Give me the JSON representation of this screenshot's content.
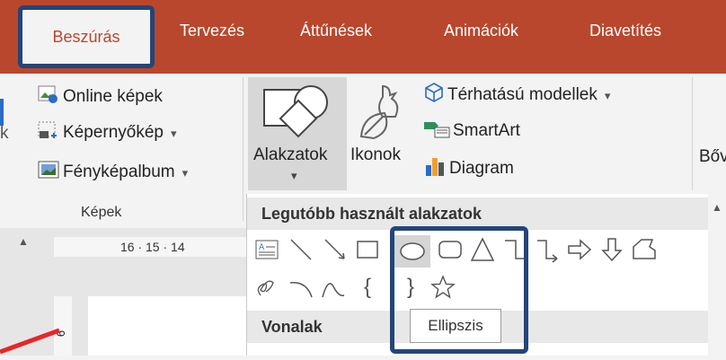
{
  "tabs": [
    {
      "label": "Beszúrás",
      "active": true
    },
    {
      "label": "Tervezés"
    },
    {
      "label": "Áttűnések"
    },
    {
      "label": "Animációk"
    },
    {
      "label": "Diavetítés"
    }
  ],
  "ribbon": {
    "images_group": {
      "online_pictures": "Online képek",
      "screenshot": "Képernyőkép",
      "photo_album": "Fényképalbum",
      "group_label": "Képek",
      "cut_text": "k"
    },
    "shapes_label": "Alakzatok",
    "icons_label": "Ikonok",
    "models_3d": "Térhatású modellek",
    "smartart": "SmartArt",
    "chart": "Diagram",
    "cut_text_right": "Bőv"
  },
  "ruler": {
    "numbers": "16 · 15 · 14",
    "left_number": "6"
  },
  "dropdown": {
    "recent_header": "Legutóbb használt alakzatok",
    "lines_header": "Vonalak",
    "tooltip": "Ellipszis",
    "brace_left": "{",
    "brace_right": "}"
  },
  "colors": {
    "accent": "#b9472d",
    "highlight": "#23467a",
    "arrow": "#e8252a"
  },
  "icons": [
    "picture-online-icon",
    "screenshot-icon",
    "photo-album-icon",
    "shapes-icon",
    "icons-icon",
    "cube-3d-icon",
    "smartart-icon",
    "chart-icon"
  ]
}
